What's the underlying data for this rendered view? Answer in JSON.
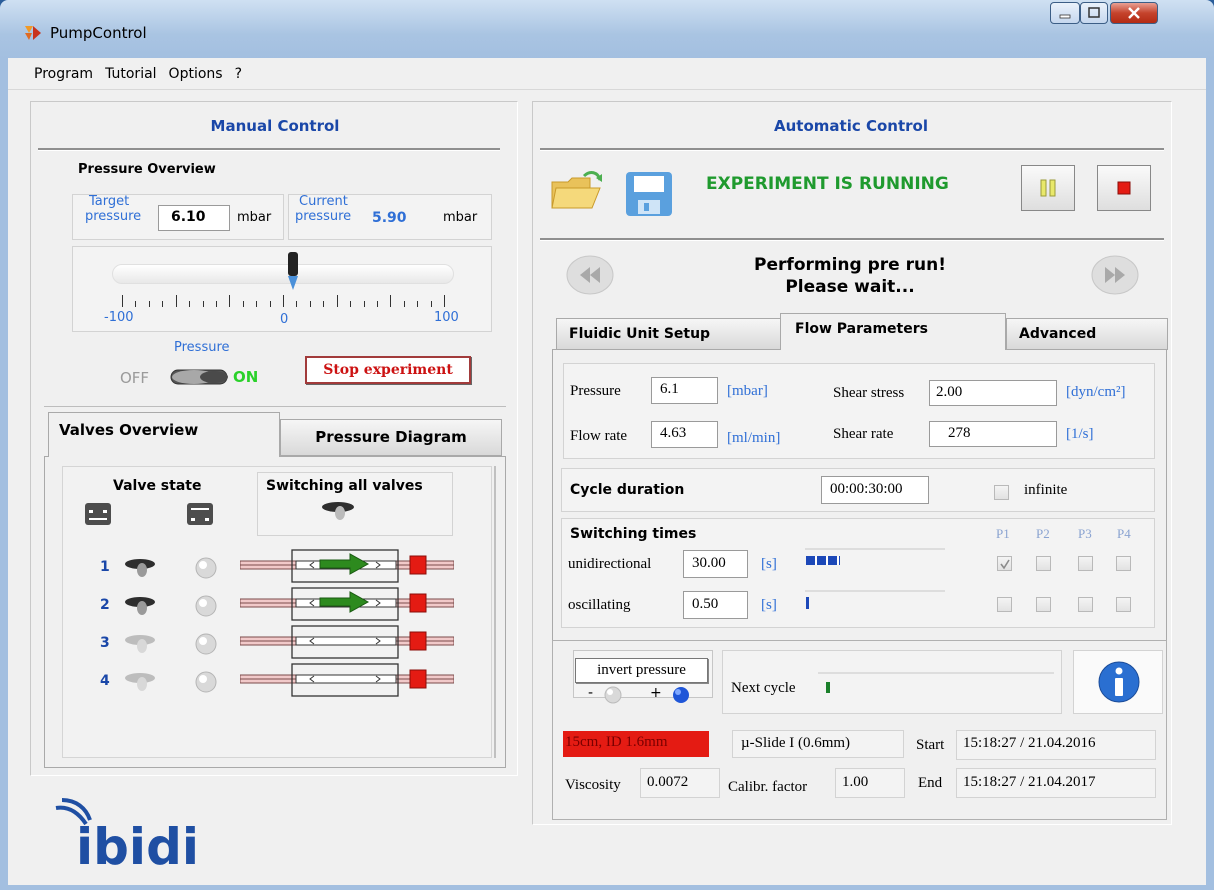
{
  "window": {
    "title": "PumpControl",
    "menu": [
      "Program",
      "Tutorial",
      "Options",
      "?"
    ]
  },
  "manual": {
    "title": "Manual Control",
    "pressure_overview": "Pressure Overview",
    "target_label_1": "Target",
    "target_label_2": "pressure",
    "target_value": "6.10",
    "target_unit": "mbar",
    "current_label_1": "Current",
    "current_label_2": "pressure",
    "current_value": "5.90",
    "current_unit": "mbar",
    "slider": {
      "min": "-100",
      "zero": "0",
      "max": "100",
      "value": 6.1
    },
    "pressure_label": "Pressure",
    "off": "OFF",
    "on": "ON",
    "stop_button": "Stop experiment"
  },
  "valves": {
    "tabs": [
      "Valves Overview",
      "Pressure Diagram"
    ],
    "valve_state": "Valve state",
    "switching_all": "Switching all valves",
    "rows": [
      {
        "num": "1",
        "active": true
      },
      {
        "num": "2",
        "active": true
      },
      {
        "num": "3",
        "active": false
      },
      {
        "num": "4",
        "active": false
      }
    ]
  },
  "auto": {
    "title": "Automatic Control",
    "status": "EXPERIMENT IS RUNNING",
    "msg1": "Performing pre run!",
    "msg2": "Please wait...",
    "tabs": [
      "Fluidic Unit Setup",
      "Flow Parameters",
      "Advanced"
    ],
    "pressure_label": "Pressure",
    "pressure_value": "6.1",
    "pressure_unit": "[mbar]",
    "flow_label": "Flow rate",
    "flow_value": "4.63",
    "flow_unit": "[ml/min]",
    "shear_stress_label": "Shear stress",
    "shear_stress_value": "2.00",
    "shear_stress_unit": "[dyn/cm²]",
    "shear_rate_label": "Shear rate",
    "shear_rate_value": "278",
    "shear_rate_unit": "[1/s]",
    "cycle_label": "Cycle duration",
    "cycle_value": "00:00:30:00",
    "infinite": "infinite",
    "switching_label": "Switching times",
    "pumps": [
      "P1",
      "P2",
      "P3",
      "P4"
    ],
    "uni_label": "unidirectional",
    "uni_value": "30.00",
    "uni_unit": "[s]",
    "uni_progress": 0.24,
    "osc_label": "oscillating",
    "osc_value": "0.50",
    "osc_unit": "[s]",
    "osc_progress": 0.02,
    "invert_label": "invert pressure",
    "minus": "-",
    "plus": "+",
    "next_cycle": "Next cycle",
    "next_progress": 0.01,
    "tubing": "15cm, ID 1.6mm",
    "slide": "µ-Slide I (0.6mm)",
    "start_label": "Start",
    "start_value": "15:18:27 / 21.04.2016",
    "end_label": "End",
    "end_value": "15:18:27 / 21.04.2017",
    "viscosity_label": "Viscosity",
    "viscosity_value": "0.0072",
    "calibr_label": "Calibr. factor",
    "calibr_value": "1.00"
  },
  "logo": "ibidi",
  "colors": {
    "accent": "#1a47a8",
    "running": "#1f9a2e",
    "alarm": "#e41b13",
    "arrow": "#2d8a1e",
    "on": "#2ad12a"
  }
}
